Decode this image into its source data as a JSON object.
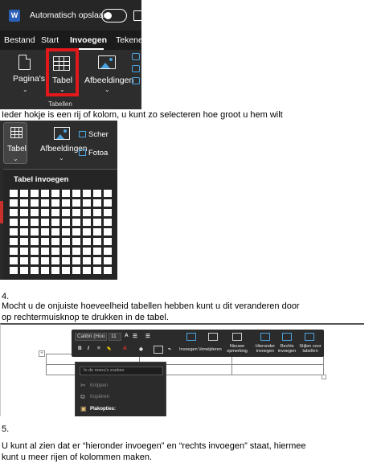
{
  "screenshot1": {
    "autosave_label": "Automatisch opslaan",
    "menu": [
      "Bestand",
      "Start",
      "Invoegen",
      "Tekene"
    ],
    "ribbon_buttons": [
      "Pagina's",
      "Tabel",
      "Afbeeldingen"
    ],
    "group_label": "Tabellen",
    "word_logo": "W"
  },
  "text1": "Ieder hokje is een rij of kolom, u kunt zo selecteren hoe groot u hem wilt",
  "screenshot2": {
    "buttons": [
      "Tabel",
      "Afbeeldingen"
    ],
    "side_labels": [
      "Scher",
      "Fotoa"
    ],
    "dropdown_title": "Tabel invoegen"
  },
  "step4_number": "4.",
  "step4_text_line1": "Mocht u de onjuiste hoeveelheid tabellen hebben kunt u dit veranderen door",
  "step4_text_line2": "op rechtermuisknop te drukken in de tabel.",
  "screenshot3": {
    "font_name": "Calibri (Hoo",
    "font_size": "11",
    "toolbar_labels": {
      "insert": "Invoegen",
      "delete": "Verwijderen",
      "new_comment": "Nieuwe opmerking",
      "insert_below": "Hieronder invoegen",
      "insert_right": "Rechts invoegen",
      "table_styles": "Stijlen voor tabellen"
    },
    "context_search": "In de menu's zoeken",
    "context_items": [
      "Knippen",
      "Kopiëren",
      "Plakopties:"
    ]
  },
  "step5_number": "5.",
  "step5_text_line1": "U kunt al zien dat er “hieronder invoegen” en “rechts invoegen” staat, hiermee",
  "step5_text_line2": "kunt u meer rijen of kolommen maken."
}
